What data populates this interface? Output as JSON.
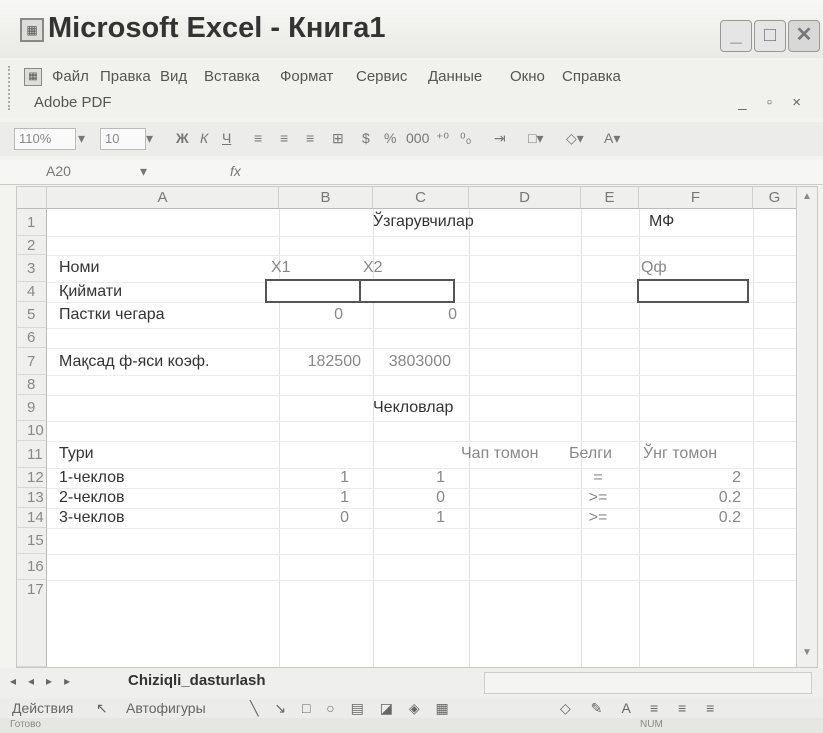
{
  "window": {
    "title": "Microsoft Excel - Книга1",
    "app_icon": "excel-icon"
  },
  "menu": {
    "items": [
      "Файл",
      "Правка",
      "Вид",
      "Вставка",
      "Формат",
      "Сервис",
      "Данные",
      "Окно",
      "Справка"
    ],
    "adobe": "Adobe PDF"
  },
  "toolbar": {
    "zoom": "110%",
    "font_size": "10",
    "bold": "Ж",
    "italic": "К",
    "underline": "Ч",
    "currency": "$",
    "percent": "%",
    "thousands": "000"
  },
  "formula": {
    "name_box": "A20",
    "fx": "fx",
    "value": ""
  },
  "columns": [
    "A",
    "B",
    "C",
    "D",
    "E",
    "F",
    "G"
  ],
  "rows": [
    "1",
    "2",
    "3",
    "4",
    "5",
    "6",
    "7",
    "8",
    "9",
    "10",
    "11",
    "12",
    "13",
    "14",
    "15",
    "16",
    "17"
  ],
  "sheet": {
    "r1_var": "Ўзгарувчилар",
    "r1_mf": "МФ",
    "r3_label": "Номи",
    "r3_x1": "X1",
    "r3_x2": "X2",
    "r3_qf": "Qф",
    "r4_label": "Қиймати",
    "r5_label": "Пастки чегара",
    "r5_b": "0",
    "r5_c": "0",
    "r7_label": "Мақсад ф-яси коэф.",
    "r7_b": "182500",
    "r7_c": "3803000",
    "r9_title": "Чекловлар",
    "r11_a": "Тури",
    "r11_d": "Чап томон",
    "r11_e": "Белги",
    "r11_f": "Ўнг томон",
    "r12_a": "1-чеклов",
    "r12_b": "1",
    "r12_c": "1",
    "r12_e": "=",
    "r12_f": "2",
    "r13_a": "2-чеклов",
    "r13_b": "1",
    "r13_c": "0",
    "r13_e": ">=",
    "r13_f": "0.2",
    "r14_a": "3-чеклов",
    "r14_b": "0",
    "r14_c": "1",
    "r14_e": ">=",
    "r14_f": "0.2"
  },
  "tabs": {
    "sheet_name": "Chiziqli_dasturlash"
  },
  "drawing": {
    "actions": "Действия",
    "autoshapes": "Автофигуры"
  },
  "status": {
    "ready": "Готово",
    "num": "NUM"
  }
}
